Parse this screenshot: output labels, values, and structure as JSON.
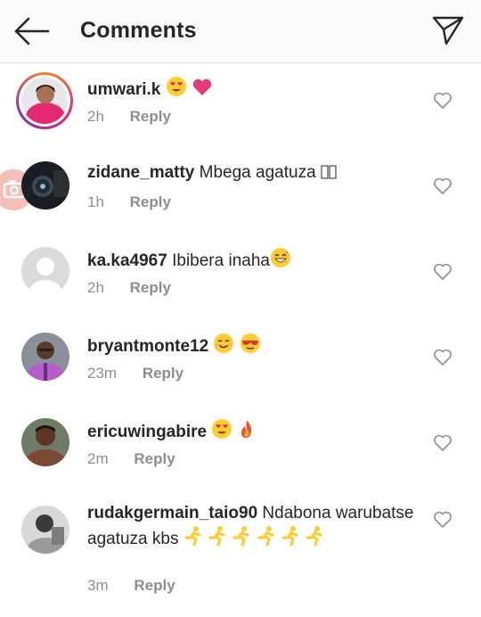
{
  "header": {
    "title": "Comments",
    "back_icon": "arrow-left-icon",
    "send_icon": "paper-plane-icon"
  },
  "comments": [
    {
      "username": "umwari.k",
      "text": "",
      "emojis": [
        "heart-eyes-emoji",
        "pink-heart-emoji"
      ],
      "time": "2h",
      "reply": "Reply",
      "has_story_ring": true
    },
    {
      "username": "zidane_matty",
      "text": " Mbega agatuza",
      "emojis": [
        "unrendered-glyph",
        "unrendered-glyph"
      ],
      "time": "1h",
      "reply": "Reply",
      "has_story_ring": false
    },
    {
      "username": "ka.ka4967",
      "text": " Ibibera inaha",
      "emojis": [
        "grinning-sweat-emoji"
      ],
      "time": "2h",
      "reply": "Reply",
      "has_story_ring": false
    },
    {
      "username": "bryantmonte12",
      "text": " ",
      "emojis": [
        "smiling-emoji",
        "sunglasses-emoji"
      ],
      "time": "23m",
      "reply": "Reply",
      "has_story_ring": false
    },
    {
      "username": "ericuwingabire",
      "text": " ",
      "emojis": [
        "heart-eyes-emoji",
        "fire-emoji"
      ],
      "time": "2m",
      "reply": "Reply",
      "has_story_ring": false
    },
    {
      "username": "rudakgermain_taio90",
      "text": " Ndabona warubatse agatuza kbs ",
      "emojis": [
        "runner-emoji",
        "runner-emoji",
        "runner-emoji",
        "runner-emoji",
        "runner-emoji",
        "runner-emoji"
      ],
      "time": "3m",
      "reply": "Reply",
      "has_story_ring": false
    }
  ],
  "colors": {
    "header_bg": "#fafafa",
    "text": "#262626",
    "meta": "#8e8e8e",
    "divider": "#dbdbdb"
  }
}
